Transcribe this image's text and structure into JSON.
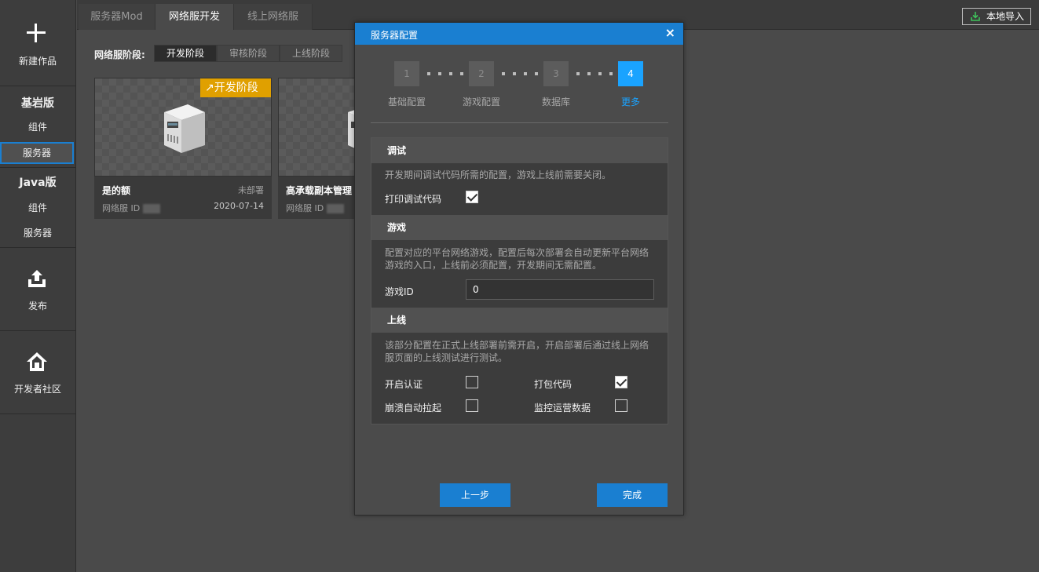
{
  "sidebar": {
    "new_label": "新建作品",
    "bedrock_heading": "基岩版",
    "bedrock_items": [
      "组件",
      "服务器"
    ],
    "java_heading": "Java版",
    "java_items": [
      "组件",
      "服务器"
    ],
    "publish_label": "发布",
    "community_label": "开发者社区"
  },
  "tabs": [
    "服务器Mod",
    "网络服开发",
    "线上网络服"
  ],
  "import_label": "本地导入",
  "stage": {
    "label": "网络服阶段:",
    "options": [
      "开发阶段",
      "审核阶段",
      "上线阶段"
    ]
  },
  "cards": [
    {
      "badge": "开发阶段",
      "title": "是的额",
      "status": "未部署",
      "id_label": "网络服 ID",
      "date": "2020-07-14"
    },
    {
      "title": "高承载副本管理",
      "id_label": "网络服 ID"
    }
  ],
  "modal": {
    "title": "服务器配置",
    "close_glyph": "×",
    "steps": [
      {
        "num": "1",
        "label": "基础配置"
      },
      {
        "num": "2",
        "label": "游戏配置"
      },
      {
        "num": "3",
        "label": "数据库"
      },
      {
        "num": "4",
        "label": "更多"
      }
    ],
    "debug": {
      "heading": "调试",
      "desc": "开发期间调试代码所需的配置，游戏上线前需要关闭。",
      "print_label": "打印调试代码",
      "print_checked": true
    },
    "game": {
      "heading": "游戏",
      "desc": "配置对应的平台网络游戏，配置后每次部署会自动更新平台网络游戏的入口，上线前必须配置，开发期间无需配置。",
      "id_label": "游戏ID",
      "id_value": "0"
    },
    "online": {
      "heading": "上线",
      "desc": "该部分配置在正式上线部署前需开启，开启部署后通过线上网络服页面的上线测试进行测试。",
      "auth_label": "开启认证",
      "pack_label": "打包代码",
      "crash_label": "崩溃自动拉起",
      "monitor_label": "监控运营数据"
    },
    "prev_label": "上一步",
    "finish_label": "完成"
  }
}
